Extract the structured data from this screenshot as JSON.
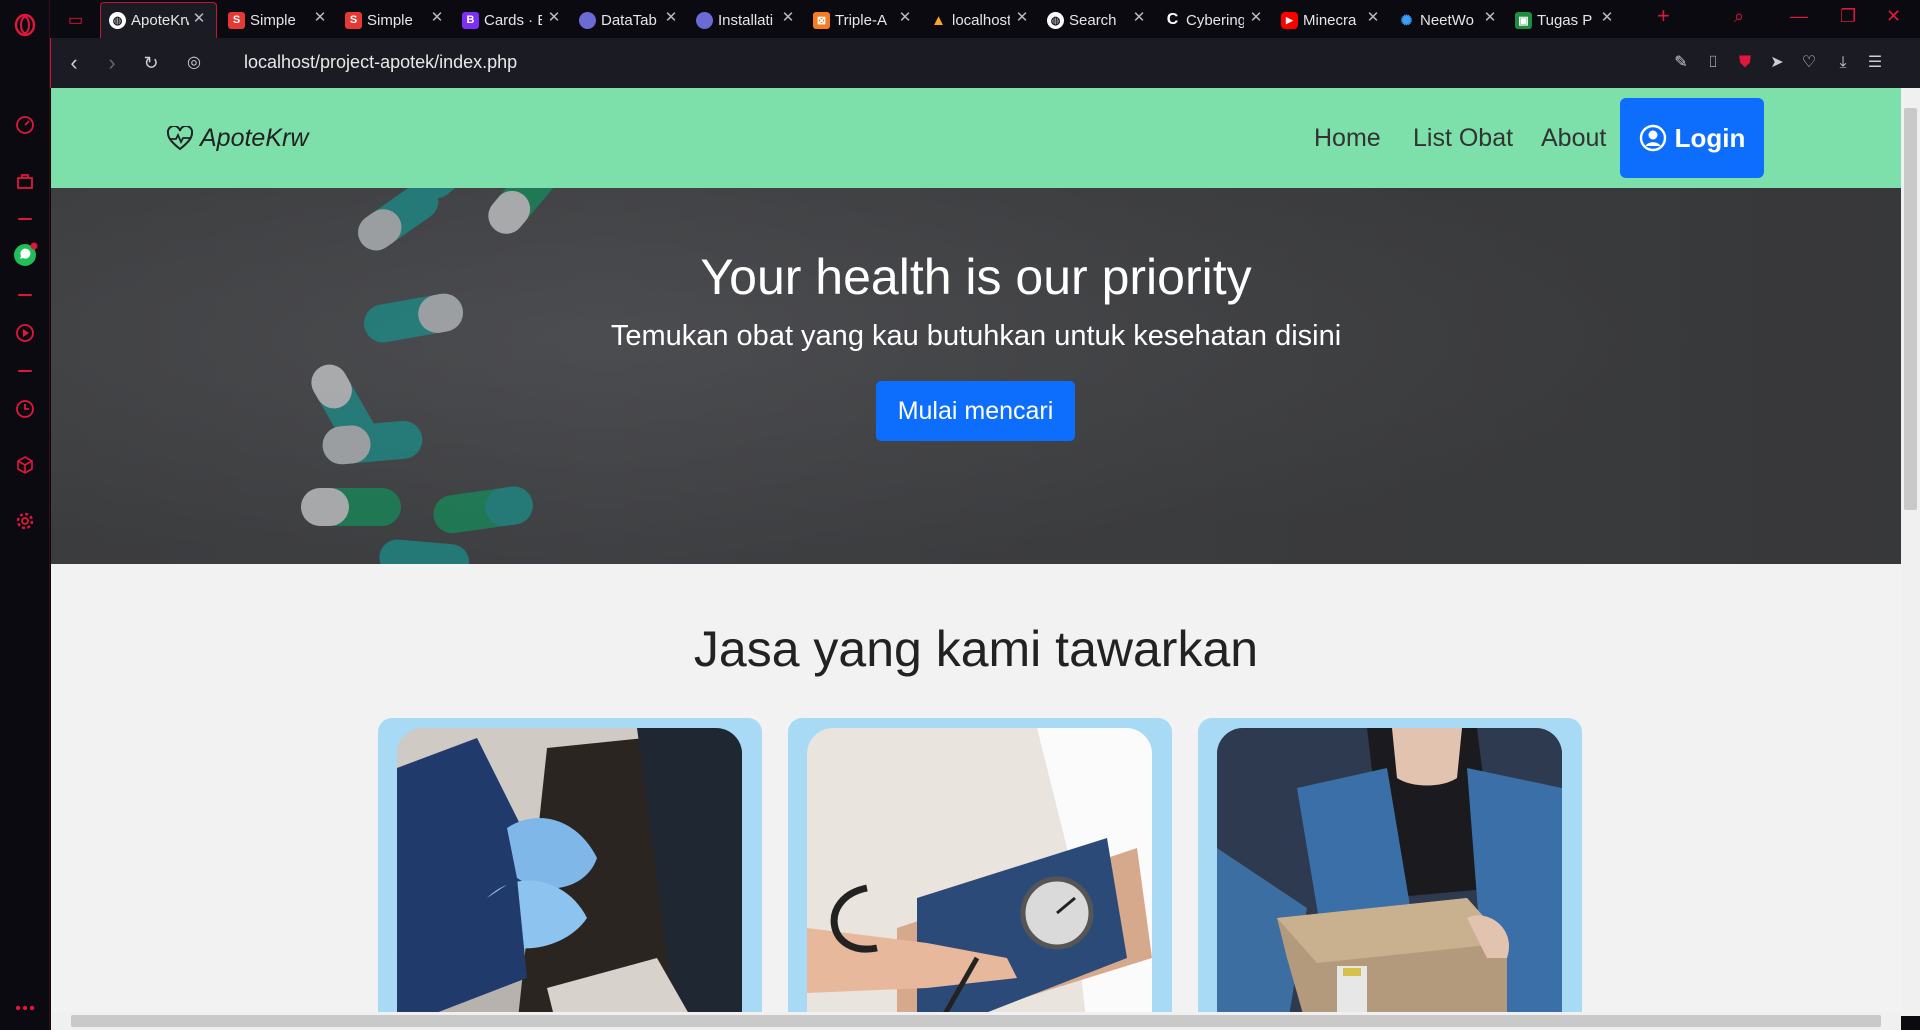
{
  "browser": {
    "tabs": [
      {
        "label": "ApoteKrw",
        "active": true,
        "favicon": "globe-icon",
        "color": "#ffffff"
      },
      {
        "label": "Simple",
        "favicon": "s-icon",
        "color": "#e53935"
      },
      {
        "label": "Simple",
        "favicon": "s-icon",
        "color": "#e53935"
      },
      {
        "label": "Cards · B",
        "favicon": "b-icon",
        "color": "#7b2ff7"
      },
      {
        "label": "DataTab",
        "favicon": "globe-icon",
        "color": "#6b6bd6"
      },
      {
        "label": "Installati",
        "favicon": "globe-icon",
        "color": "#6b6bd6"
      },
      {
        "label": "Triple-A",
        "favicon": "xampp-icon",
        "color": "#f57c22"
      },
      {
        "label": "localhost",
        "favicon": "localhost-icon",
        "color": "#f5a623"
      },
      {
        "label": "Search",
        "favicon": "globe-icon",
        "color": "#ffffff"
      },
      {
        "label": "Cybering",
        "favicon": "c-icon",
        "color": "#ffffff"
      },
      {
        "label": "Minecra",
        "favicon": "youtube-icon",
        "color": "#ff0000"
      },
      {
        "label": "NeetWo",
        "favicon": "network-icon",
        "color": "#3aa0ff"
      },
      {
        "label": "Tugas P",
        "favicon": "classroom-icon",
        "color": "#1e8e3e"
      }
    ],
    "url": "localhost/project-apotek/index.php"
  },
  "site": {
    "brand": "ApoteKrw",
    "nav": {
      "home": "Home",
      "list": "List Obat",
      "about": "About",
      "login": "Login"
    },
    "hero": {
      "title": "Your health is our priority",
      "subtitle": "Temukan obat yang kau butuhkan untuk kesehatan disini",
      "cta": "Mulai mencari"
    },
    "services_title": "Jasa yang kami tawarkan"
  },
  "colors": {
    "navbar": "#7ddfa9",
    "primary": "#0d6efd",
    "card_bg": "#a9daf5",
    "accent": "#e0173c"
  }
}
